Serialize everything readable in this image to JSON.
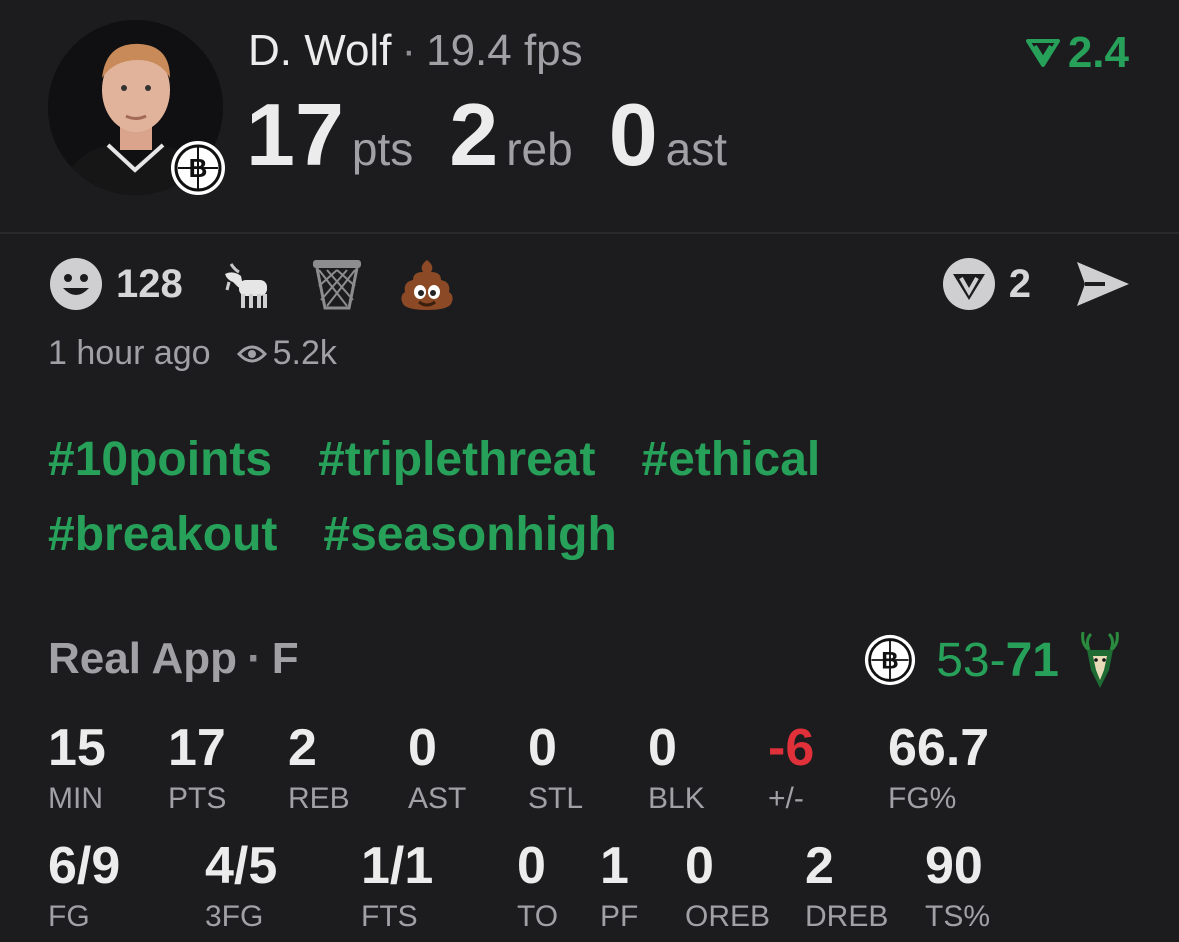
{
  "player": {
    "name": "D. Wolf",
    "fps": "19.4 fps",
    "rating": "2.4",
    "stats": [
      {
        "value": "17",
        "unit": "pts"
      },
      {
        "value": "2",
        "unit": "reb"
      },
      {
        "value": "0",
        "unit": "ast"
      }
    ]
  },
  "reactions": {
    "count": "128",
    "comments": "2"
  },
  "meta": {
    "time": "1 hour ago",
    "views": "5.2k"
  },
  "hashtags": [
    "#10points",
    "#triplethreat",
    "#ethical",
    "#breakout",
    "#seasonhigh"
  ],
  "game": {
    "source": "Real App",
    "status": "F",
    "score_home": "53",
    "score_separator": "-",
    "score_away": "71"
  },
  "boxscore": {
    "row1": [
      {
        "value": "15",
        "label": "MIN"
      },
      {
        "value": "17",
        "label": "PTS"
      },
      {
        "value": "2",
        "label": "REB"
      },
      {
        "value": "0",
        "label": "AST"
      },
      {
        "value": "0",
        "label": "STL"
      },
      {
        "value": "0",
        "label": "BLK"
      },
      {
        "value": "-6",
        "label": "+/-"
      },
      {
        "value": "66.7",
        "label": "FG%"
      }
    ],
    "row2": [
      {
        "value": "6/9",
        "label": "FG"
      },
      {
        "value": "4/5",
        "label": "3FG"
      },
      {
        "value": "1/1",
        "label": "FTS"
      },
      {
        "value": "0",
        "label": "TO"
      },
      {
        "value": "1",
        "label": "PF"
      },
      {
        "value": "0",
        "label": "OREB"
      },
      {
        "value": "2",
        "label": "DREB"
      },
      {
        "value": "90",
        "label": "TS%"
      }
    ]
  },
  "colors": {
    "accent_green": "#27a15a",
    "negative_red": "#e0313a",
    "background": "#1c1c1e"
  },
  "icons": [
    "smile-icon",
    "goat-icon",
    "basketball-hoop-icon",
    "poop-icon",
    "comment-v-icon",
    "send-icon",
    "eye-icon",
    "nets-logo-icon",
    "bucks-logo-icon",
    "rating-v-icon"
  ]
}
